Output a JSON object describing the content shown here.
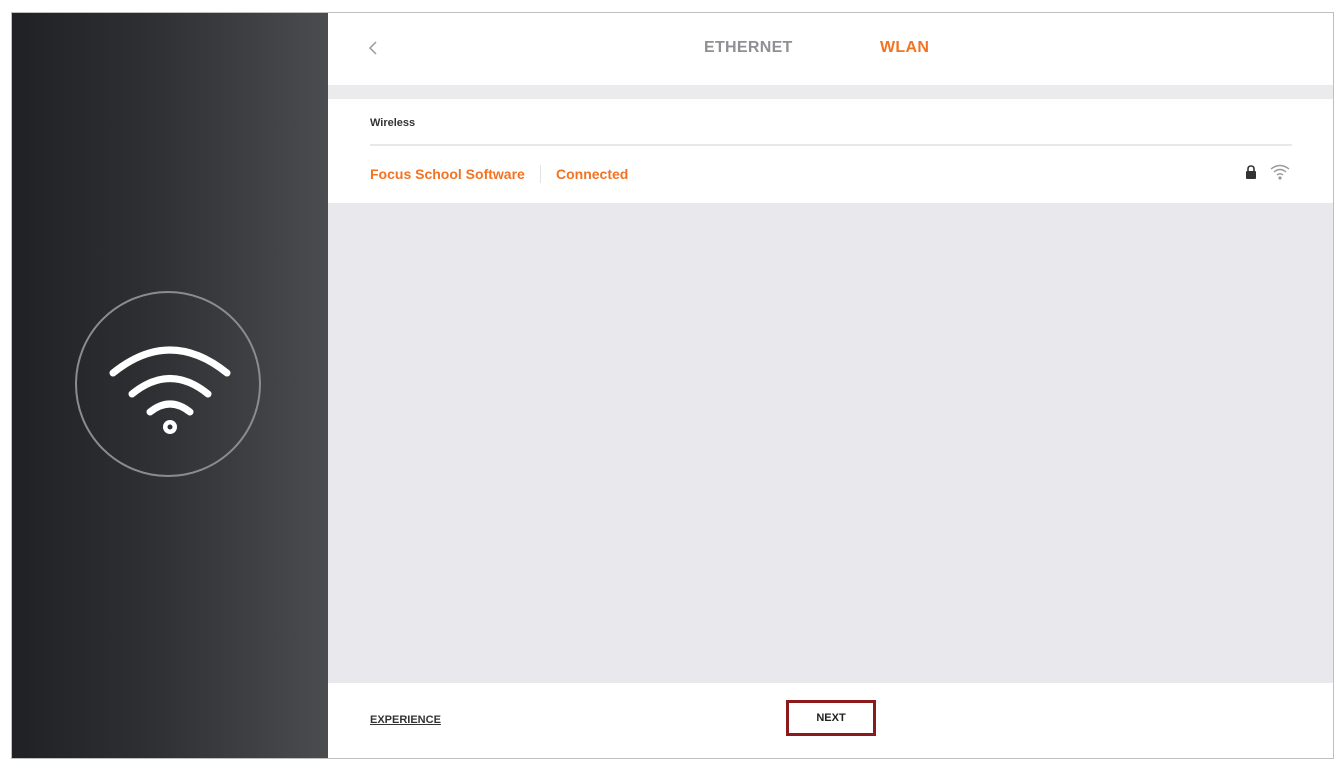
{
  "header": {
    "back_icon": "chevron-left-icon",
    "tabs": [
      {
        "label": "ETHERNET",
        "active": false
      },
      {
        "label": "WLAN",
        "active": true
      }
    ]
  },
  "wireless": {
    "section_label": "Wireless",
    "networks": [
      {
        "name": "Focus School Software",
        "status": "Connected",
        "secured_icon": "lock-icon",
        "signal_icon": "wifi-signal-icon"
      }
    ]
  },
  "footer": {
    "experience_label": "EXPERIENCE",
    "next_label": "NEXT"
  },
  "left_panel": {
    "icon": "wifi-icon"
  },
  "colors": {
    "accent": "#f47321",
    "inactive_tab": "#8e9094",
    "highlight_border": "#8b1a1a",
    "list_background": "#e9e9ed"
  }
}
